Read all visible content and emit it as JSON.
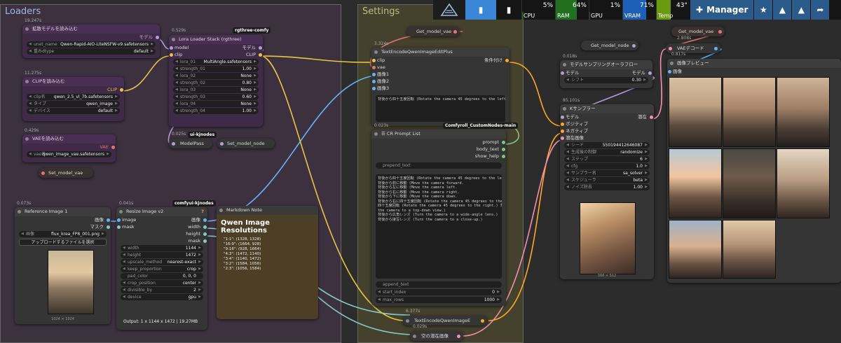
{
  "groups": {
    "loaders": "Loaders",
    "settings": "Settings"
  },
  "topbar": {
    "cpu": {
      "label": "CPU",
      "value": "5%"
    },
    "ram": {
      "label": "RAM",
      "value": "64%"
    },
    "gpu": {
      "label": "GPU",
      "value": "1%"
    },
    "vram": {
      "label": "VRAM",
      "value": "71%"
    },
    "temp": {
      "label": "Temp",
      "value": "43°"
    },
    "manager": "Manager",
    "colors": {
      "cpu": "#1f5f1f",
      "ram": "#207020",
      "gpu": "#1d1d1d",
      "vram": "#1e5fb8",
      "temp": "#6a9a10"
    }
  },
  "unet": {
    "time": "19.247s",
    "title": "拡散モデルを読み込む",
    "out": "モデル",
    "w1l": "unet_name",
    "w1v": "Qwen-Rapid-AIO-LiteNSFW-v9.safetensors",
    "w2l": "重みdtype",
    "w2v": "default"
  },
  "clip": {
    "time": "11.275s",
    "title": "CLIPを読み込む",
    "out": "CLIP",
    "w1l": "clip名",
    "w1v": "qwen_2.5_vl_7b.safetensors",
    "w2l": "タイプ",
    "w2v": "qwen_image",
    "w3l": "デバイス",
    "w3v": "default"
  },
  "vae": {
    "time": "0.429s",
    "title": "VAEを読み込む",
    "out": "VAE",
    "w1l": "vae名",
    "w1v": "qwen_image_vae.safetensors"
  },
  "setmodelvae": "Set_model_vae",
  "lora": {
    "time": "0.529s",
    "badge": "rgthree-comfy",
    "title": "Lora Loader Stack (rgthree)",
    "in1": "model",
    "in2": "clip",
    "out1": "モデル",
    "out2": "CLIP",
    "rows": [
      {
        "l": "lora_01",
        "v": "MultiAngle.safetensors"
      },
      {
        "l": "strength_01",
        "v": "1.00"
      },
      {
        "l": "lora_02",
        "v": "None"
      },
      {
        "l": "strength_02",
        "v": "0.80"
      },
      {
        "l": "lora_03",
        "v": "None"
      },
      {
        "l": "strength_03",
        "v": "0.60"
      },
      {
        "l": "lora_04",
        "v": "None"
      },
      {
        "l": "strength_04",
        "v": "1.00"
      }
    ]
  },
  "modelpass": {
    "time": "0.025s",
    "badge": "ui-kjnodes",
    "title": "ModelPass"
  },
  "setmodelnode": "Set_model_node",
  "refimg": {
    "time": "0.073s",
    "title": "Reference Image 1",
    "out1": "画像",
    "out2": "マスク",
    "w1l": "画像",
    "w1v": "flux_krea_FP8_001.png",
    "btn": "アップロードするファイルを選択",
    "size": "1024 × 1024"
  },
  "resize": {
    "time": "0.041s",
    "badge": "comfyui-kjnodes",
    "title": "Resize Image v2",
    "in1": "image",
    "in2": "mask",
    "out1": "画像",
    "out2": "width",
    "out3": "height",
    "out4": "mask",
    "rows": [
      {
        "l": "width",
        "v": "1144"
      },
      {
        "l": "height",
        "v": "1472"
      },
      {
        "l": "upscale_method",
        "v": "nearest-exact"
      },
      {
        "l": "keep_proportion",
        "v": "crop"
      },
      {
        "l": "pad_color",
        "v": "0, 0, 0"
      },
      {
        "l": "crop_position",
        "v": "center"
      },
      {
        "l": "divisible_by",
        "v": "2"
      },
      {
        "l": "device",
        "v": "gpu"
      }
    ],
    "output": "Output: 1 x 1144 x 1472 | 19.27MB"
  },
  "markdown": {
    "title": "Markdown Note",
    "heading": "Qwen Image Resolutions",
    "lines": [
      "\"1:1\": (1328, 1328)",
      "\"16:9\": (1664, 928)",
      "\"9:16\": (928, 1664)",
      "\"4:3\": (1472, 1140)",
      "\"3:4\": (1140, 1472)",
      "\"3:2\": (1584, 1056)",
      "\"2:3\": (1056, 1584)"
    ]
  },
  "getmodelvae1": "Get_model_vae",
  "tenc": {
    "time": "3.324s",
    "title": "TextEncodeQwenImageEditPlus",
    "in": [
      "clip",
      "vae",
      "画像1",
      "画像2",
      "画像3"
    ],
    "out": "条件付け",
    "text": "背後から四十五度回転 (Rotate the camera 45 degrees to the left.",
    "badge": "Comfyroll_CustomNodes-main"
  },
  "crprompt": {
    "time": "0.023s",
    "title": "CR Prompt List",
    "in": [
      "prompt",
      "body_text",
      "show_help"
    ],
    "prepend": "prepend_text",
    "list": "背後から四十五度回転 (Rotate the camera 45 degrees to the left.\n背後から前に移動 (Move the camera forward.\n背後から左に移動 (Move the camera left.\n背後から右に移動 (Move the camera right.\n背後から下に移動 (Move the camera down.\n背後から右に四十五度回転 (Rotate the camera 45 degrees to the left.) 背後から前にカメラ\n四十五度回転 (Rotate the camera 45 degrees to the right.) 背後から下から上に (Turn\nthe camera to a top-down view.)\n背後から広角レンズ (Turn the camera to a wide-angle lens.)\n背後から接写レンズ (Turn the camera to a close-up.)",
    "append": "append_text",
    "w1l": "start_index",
    "w1v": "0",
    "w2l": "max_rows",
    "w2v": "1000"
  },
  "tenc2": {
    "time": "6.377s",
    "title": "TextEncodeQwenImageE"
  },
  "latent": {
    "time": "0.029s",
    "title": "空の潜在画像"
  },
  "getmodelnode": "Get_model_node",
  "sampling": {
    "time": "0.018s",
    "title": "モデルサンプリングオーラフロー",
    "in": "モデル",
    "out": "モデル",
    "w1l": "シフト",
    "w1v": "0.30"
  },
  "ksampler": {
    "time": "85.101s",
    "title": "Kサンプラー",
    "in": [
      "モデル",
      "ポジティブ",
      "ネガティブ",
      "潜在画像"
    ],
    "out": "潜在",
    "rows": [
      {
        "l": "シード",
        "v": "550194412646087"
      },
      {
        "l": "生成後の制御",
        "v": "randomize"
      },
      {
        "l": "ステップ",
        "v": "6"
      },
      {
        "l": "cfg",
        "v": "1.0"
      },
      {
        "l": "サンプラー名",
        "v": "sa_solver"
      },
      {
        "l": "スケジューラ",
        "v": "beta"
      },
      {
        "l": "ノイズ除去",
        "v": "1.00"
      }
    ],
    "size": "368 × 512"
  },
  "getmodelvae2": "Get_model_vae",
  "vaedecode": {
    "time": "2.808s",
    "title": "VAEデコード"
  },
  "preview": {
    "time": "0.817s",
    "title": "画像プレビュー",
    "in": "画像"
  }
}
